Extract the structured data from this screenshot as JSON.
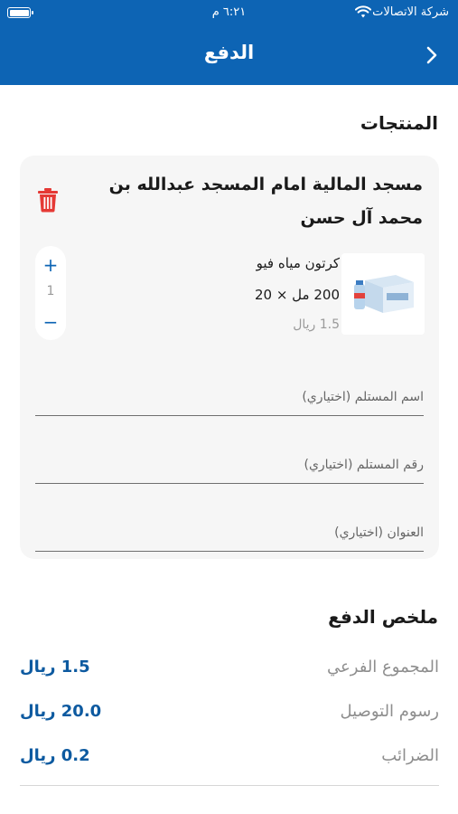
{
  "status_bar": {
    "carrier": "شركة الاتصالات",
    "time": "٦:٢١ م"
  },
  "header": {
    "title": "الدفع",
    "back_icon": "chevron-right-icon"
  },
  "products_section": {
    "title": "المنتجات"
  },
  "location": {
    "name": "مسجد المالية امام المسجد عبدالله بن محمد آل حسن"
  },
  "product": {
    "name": "كرتون مياه فيو",
    "size": "200 مل × 20",
    "price": "1.5 ريال",
    "quantity": "1",
    "plus": "+",
    "minus": "−"
  },
  "fields": {
    "recipient_name": {
      "placeholder": "اسم المستلم (اختياري)"
    },
    "recipient_phone": {
      "placeholder": "رقم المستلم (اختياري)"
    },
    "address": {
      "placeholder": "العنوان (اختياري)"
    }
  },
  "summary": {
    "title": "ملخص الدفع",
    "rows": [
      {
        "label": "المجموع الفرعي",
        "value": "1.5 ريال"
      },
      {
        "label": "رسوم التوصيل",
        "value": "20.0 ريال"
      },
      {
        "label": "الضرائب",
        "value": "0.2 ريال"
      }
    ]
  },
  "colors": {
    "primary": "#0d64b4",
    "delete": "#e53935",
    "card_bg": "#f6f6f6"
  }
}
